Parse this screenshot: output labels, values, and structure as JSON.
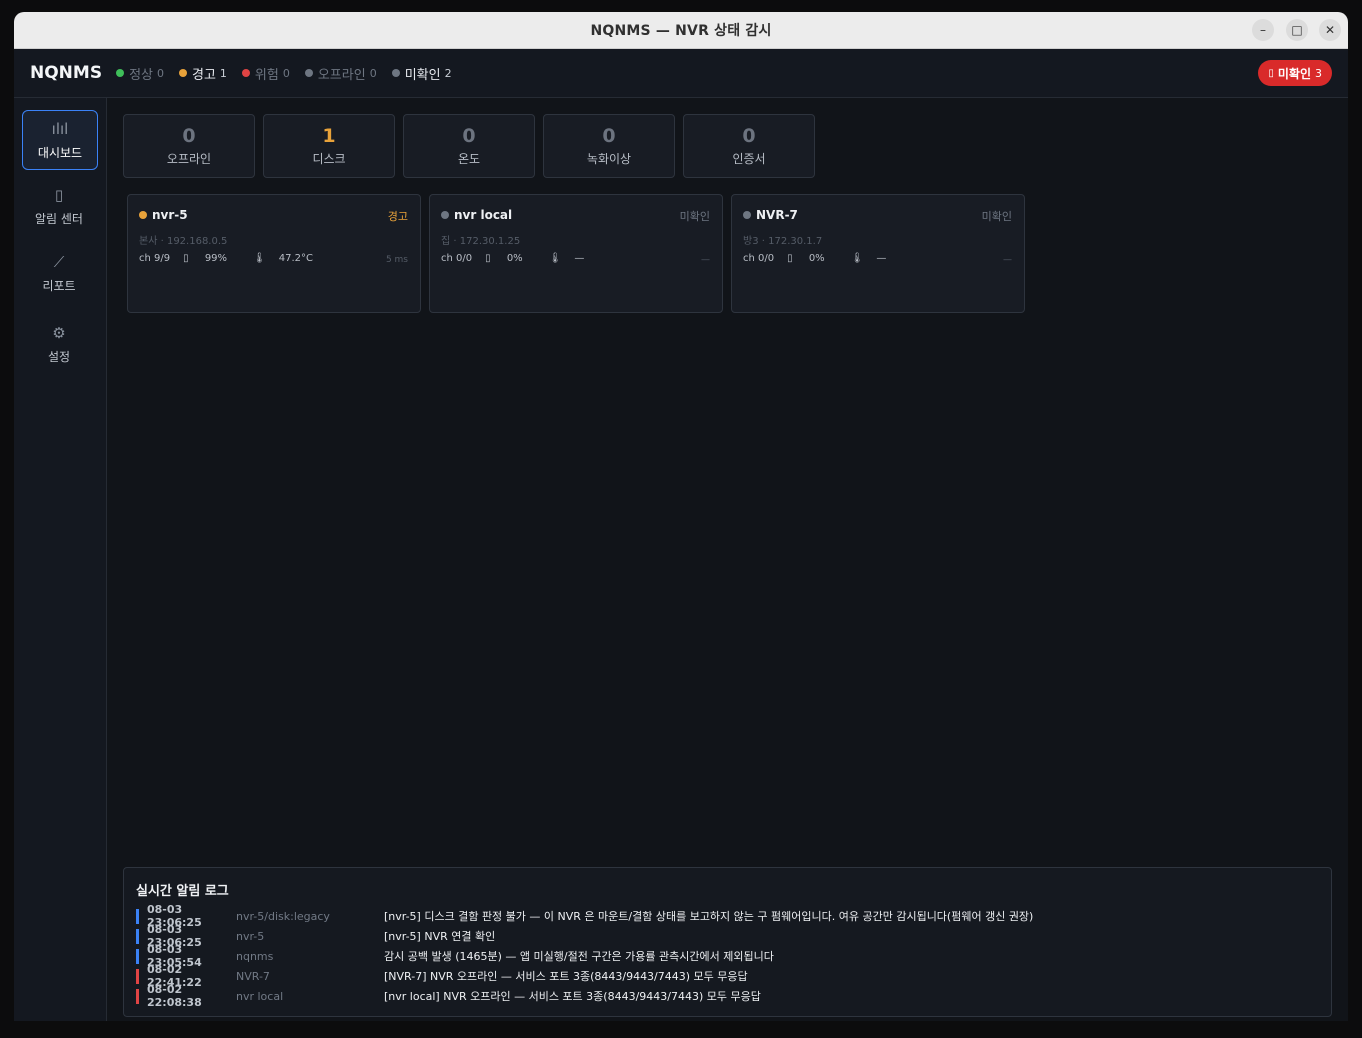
{
  "window": {
    "title": "NQNMS — NVR 상태 감시"
  },
  "header": {
    "brand": "NQNMS",
    "stats": [
      {
        "label": "정상",
        "count": "0",
        "color": "#3fbf5a",
        "active": false
      },
      {
        "label": "경고",
        "count": "1",
        "color": "#e8a23a",
        "active": true
      },
      {
        "label": "위험",
        "count": "0",
        "color": "#e04444",
        "active": false
      },
      {
        "label": "오프라인",
        "count": "0",
        "color": "#6e7682",
        "active": false
      },
      {
        "label": "미확인",
        "count": "2",
        "color": "#6e7682",
        "active": true
      }
    ],
    "unack_button": {
      "label": "미확인",
      "count": "3",
      "color": "#d92a2a"
    }
  },
  "sidebar": {
    "items": [
      {
        "label": "대시보드",
        "icon": "bar-chart-icon",
        "active": true
      },
      {
        "label": "알림 센터",
        "icon": "bell-icon",
        "active": false
      },
      {
        "label": "리포트",
        "icon": "line-chart-icon",
        "active": false
      },
      {
        "label": "설정",
        "icon": "gear-icon",
        "active": false
      }
    ]
  },
  "summary": [
    {
      "value": "0",
      "label": "오프라인"
    },
    {
      "value": "1",
      "label": "디스크"
    },
    {
      "value": "0",
      "label": "온도"
    },
    {
      "value": "0",
      "label": "녹화이상"
    },
    {
      "value": "0",
      "label": "인증서"
    }
  ],
  "nvrs": [
    {
      "name": "nvr-5",
      "status": "경고",
      "dot_color": "#e8a23a",
      "location": "본사",
      "ip": "192.168.0.5",
      "channels": "ch 9/9",
      "disk": "99%",
      "temp": "47.2°C",
      "latency": "5 ms"
    },
    {
      "name": "nvr local",
      "status": "미확인",
      "dot_color": "#6e7682",
      "location": "집",
      "ip": "172.30.1.25",
      "channels": "ch 0/0",
      "disk": "0%",
      "temp": "—",
      "latency": "—"
    },
    {
      "name": "NVR-7",
      "status": "미확인",
      "dot_color": "#6e7682",
      "location": "방3",
      "ip": "172.30.1.7",
      "channels": "ch 0/0",
      "disk": "0%",
      "temp": "—",
      "latency": "—"
    }
  ],
  "log": {
    "title": "실시간 알림 로그",
    "rows": [
      {
        "time": "08-03 23:06:25",
        "source": "nvr-5/disk:legacy",
        "message": "[nvr-5] 디스크 결함 판정 불가 — 이 NVR 은 마운트/결함 상태를 보고하지 않는 구 펌웨어입니다. 여유 공간만 감시됩니다(펌웨어 갱신 권장)",
        "color": "#3b82f6"
      },
      {
        "time": "08-03 23:06:25",
        "source": "nvr-5",
        "message": "[nvr-5] NVR 연결 확인",
        "color": "#3b82f6"
      },
      {
        "time": "08-03 23:05:54",
        "source": "nqnms",
        "message": "감시 공백 발생 (1465분) — 앱 미실행/절전 구간은 가용률 관측시간에서 제외됩니다",
        "color": "#3b82f6"
      },
      {
        "time": "08-02 22:41:22",
        "source": "NVR-7",
        "message": "[NVR-7] NVR 오프라인 — 서비스 포트 3종(8443/9443/7443) 모두 무응답",
        "color": "#e04444"
      },
      {
        "time": "08-02 22:08:38",
        "source": "nvr local",
        "message": "[nvr local] NVR 오프라인 — 서비스 포트 3종(8443/9443/7443) 모두 무응답",
        "color": "#e04444"
      }
    ]
  }
}
